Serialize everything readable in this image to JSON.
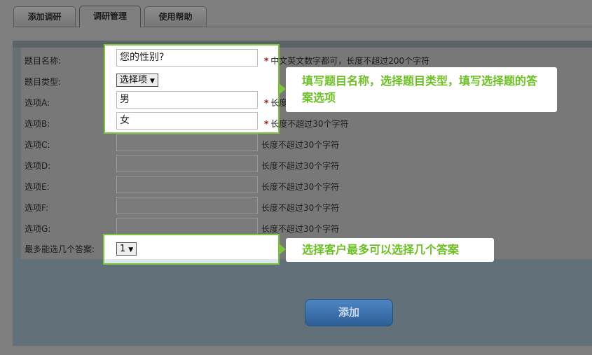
{
  "tabs": [
    {
      "label": "添加调研"
    },
    {
      "label": "调研管理"
    },
    {
      "label": "使用帮助"
    }
  ],
  "form": {
    "title_label": "题目名称:",
    "title_value": "您的性别?",
    "title_hint": "中文英文数字都可，长度不超过200个字符",
    "type_label": "题目类型:",
    "type_value": "选择项",
    "options": [
      {
        "label": "选项A:",
        "value": "男",
        "hint": "长度"
      },
      {
        "label": "选项B:",
        "value": "女",
        "hint": "长度不超过30个字符"
      },
      {
        "label": "选项C:",
        "value": "",
        "hint": "长度不超过30个字符"
      },
      {
        "label": "选项D:",
        "value": "",
        "hint": "长度不超过30个字符"
      },
      {
        "label": "选项E:",
        "value": "",
        "hint": "长度不超过30个字符"
      },
      {
        "label": "选项F:",
        "value": "",
        "hint": "长度不超过30个字符"
      },
      {
        "label": "选项G:",
        "value": "",
        "hint": "长度不超过30个字符"
      }
    ],
    "max_label": "最多能选几个答案:",
    "max_value": "1",
    "submit_label": "添加"
  },
  "callouts": {
    "top": "填写题目名称，选择题目类型，填写选择题的答案选项",
    "bottom": "选择客户最多可以选择几个答案"
  },
  "colors": {
    "highlight_border": "#7cc63a",
    "callout_text": "#6cc023",
    "required_star": "#a71010",
    "button": "#3a6fa8"
  }
}
